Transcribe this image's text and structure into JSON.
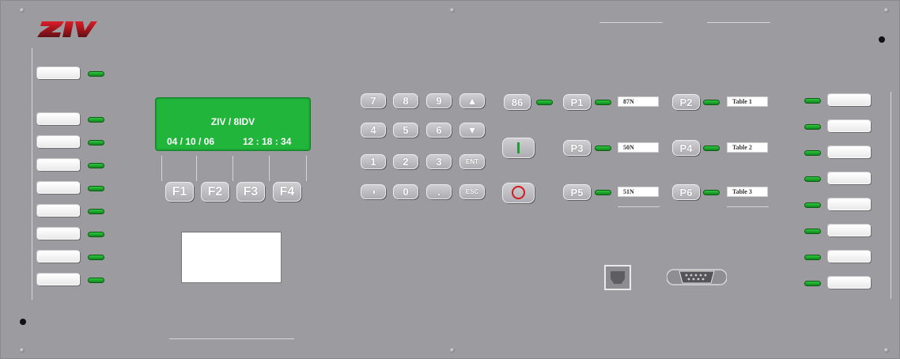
{
  "device": {
    "brand": "ZIV",
    "colors": {
      "panel": "#9c9b9f",
      "led_green": "#22b036",
      "lcd_green": "#21b53c",
      "logo_red": "#b5121b"
    }
  },
  "display": {
    "line1": "ZIV / 8IDV",
    "date": "04 / 10 / 06",
    "time": "12 : 18 : 34"
  },
  "function_keys": [
    "F1",
    "F2",
    "F3",
    "F4"
  ],
  "keypad": {
    "rows": [
      [
        "7",
        "8",
        "9",
        "▲"
      ],
      [
        "4",
        "5",
        "6",
        "▼"
      ],
      [
        "1",
        "2",
        "3",
        "ENT"
      ],
      [
        "◑",
        "0",
        ".",
        "ESC"
      ]
    ]
  },
  "trip_key": "86",
  "control_buttons": {
    "close_icon": "green-bar-icon",
    "open_icon": "red-circle-icon"
  },
  "program_keys": [
    {
      "key": "P1",
      "label": "87N"
    },
    {
      "key": "P2",
      "label": "Table 1"
    },
    {
      "key": "P3",
      "label": "50N"
    },
    {
      "key": "P4",
      "label": "Table 2"
    },
    {
      "key": "P5",
      "label": "51N"
    },
    {
      "key": "P6",
      "label": "Table 3"
    }
  ],
  "left_indicators_count": 9,
  "right_indicators_count": 8,
  "ports": {
    "front_usb": "usb-port-icon",
    "serial": "db9-port-icon"
  }
}
